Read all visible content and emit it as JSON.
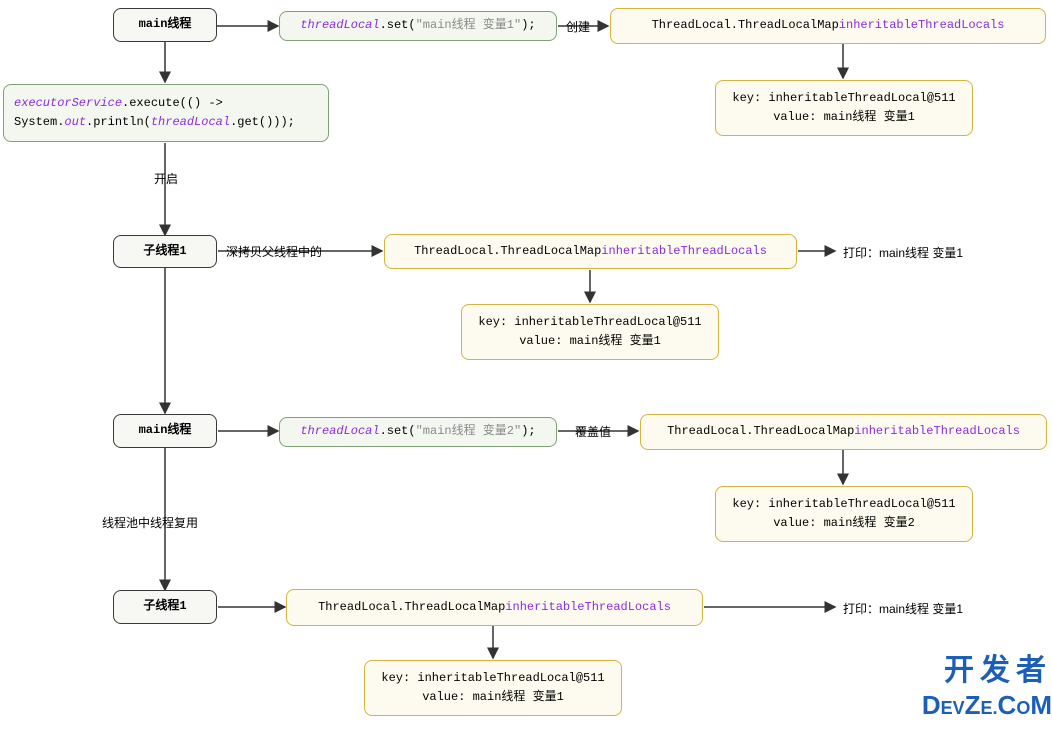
{
  "nodes": {
    "main1": "main线程",
    "set1_a": "threadLocal",
    "set1_b": ".set(",
    "set1_c": "\"main线程 变量1\"",
    "set1_d": ");",
    "exec_a": "executorService",
    "exec_b": ".execute(() ->",
    "exec_c1": "System.",
    "exec_c2": "out",
    "exec_c3": ".println(",
    "exec_c4": "threadLocal",
    "exec_c5": ".get()));",
    "map1a": "ThreadLocal.ThreadLocalMap ",
    "map1b": "inheritableThreadLocals",
    "kv1_key": "key: inheritableThreadLocal@511",
    "kv1_val": "value: main线程 变量1",
    "child1": "子线程1",
    "map2a": "ThreadLocal.ThreadLocalMap ",
    "map2b": "inheritableThreadLocals",
    "kv2_key": "key: inheritableThreadLocal@511",
    "kv2_val": "value: main线程 变量1",
    "main2": "main线程",
    "set2_a": "threadLocal",
    "set2_b": ".set(",
    "set2_c": "\"main线程 变量2\"",
    "set2_d": ");",
    "map3a": "ThreadLocal.ThreadLocalMap ",
    "map3b": "inheritableThreadLocals",
    "kv3_key": "key: inheritableThreadLocal@511",
    "kv3_val": "value: main线程 变量2",
    "child2": "子线程1",
    "map4a": "ThreadLocal.ThreadLocalMap ",
    "map4b": "inheritableThreadLocals",
    "kv4_key": "key: inheritableThreadLocal@511",
    "kv4_val": "value: main线程 变量1"
  },
  "labels": {
    "create": "创建",
    "start": "开启",
    "deepcopy": "深拷贝父线程中的",
    "print1": "打印：main线程 变量1",
    "override": "覆盖值",
    "reuse": "线程池中线程复用",
    "print2": "打印：main线程 变量1"
  },
  "watermark": {
    "line1": "开发者",
    "line2a": "D",
    "line2b": "EV",
    "line2c": "Z",
    "line2d": "E.",
    "line2e": "C",
    "line2f": "O",
    "line2g": "M"
  }
}
